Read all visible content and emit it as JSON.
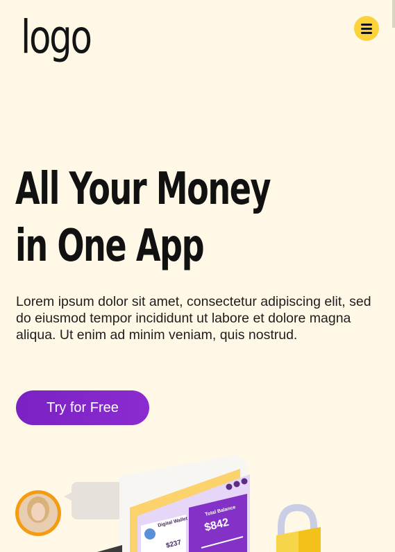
{
  "header": {
    "logo_text": "logo"
  },
  "hero": {
    "title_line1": "All Your Money",
    "title_line2": "in One App",
    "description": "Lorem ipsum dolor sit amet, consectetur adipiscing elit, sed do eiusmod tempor incididunt ut labore et dolore magna aliqua. Ut enim ad minim veniam, quis nostrud.",
    "cta_label": "Try for Free"
  },
  "illustration": {
    "wallet_title": "Digital Wallet",
    "wallet_amount": "$237",
    "balance_label": "Total Balance",
    "balance_amount": "$842"
  },
  "colors": {
    "background": "#fff8e6",
    "accent_yellow": "#fcd23a",
    "brand_purple": "#7a22c4"
  }
}
